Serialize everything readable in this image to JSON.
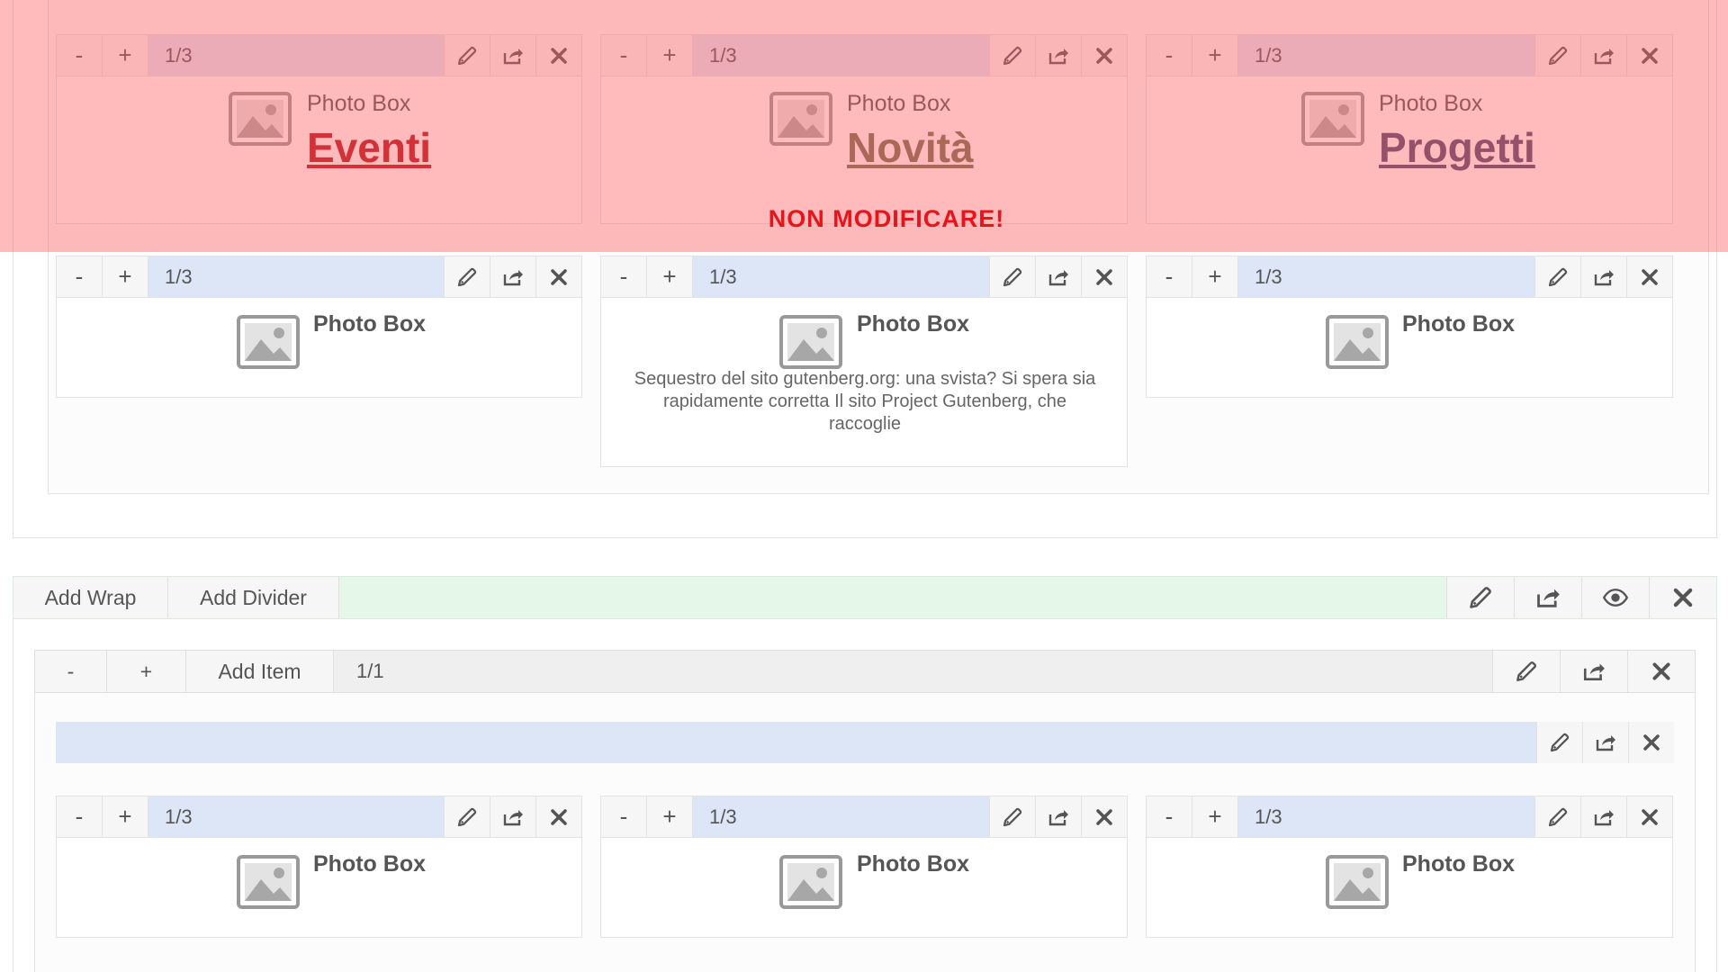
{
  "top_row": [
    {
      "size": "1/3",
      "title": "Photo Box",
      "link": "Eventi"
    },
    {
      "size": "1/3",
      "title": "Photo Box",
      "link": "Novità"
    },
    {
      "size": "1/3",
      "title": "Photo Box",
      "link": "Progetti"
    }
  ],
  "second_row": [
    {
      "size": "1/3",
      "title": "Photo Box"
    },
    {
      "size": "1/3",
      "title": "Photo Box",
      "excerpt_lines": [
        "Sequestro del sito gutenberg.org: una svista? Si spera sia",
        "rapidamente corretta Il sito Project Gutenberg, che",
        "raccoglie"
      ]
    },
    {
      "size": "1/3",
      "title": "Photo Box"
    }
  ],
  "warning": "NON MODIFICARE!",
  "wrap_bar": {
    "add_wrap": "Add Wrap",
    "add_divider": "Add Divider"
  },
  "row_bar": {
    "minus": "-",
    "plus": "+",
    "add_item": "Add Item",
    "size": "1/1"
  },
  "bottom_row": [
    {
      "size": "1/3",
      "title": "Photo Box"
    },
    {
      "size": "1/3",
      "title": "Photo Box"
    },
    {
      "size": "1/3",
      "title": "Photo Box"
    }
  ],
  "controls": {
    "minus": "-",
    "plus": "+"
  },
  "colors": {
    "eventi": "#b0131b",
    "novita": "#6f7054",
    "progetti": "#4a4a72",
    "warning": "#e8141b",
    "overlay": "#ff5a5f"
  },
  "icons": [
    "pencil-icon",
    "share-icon",
    "close-icon",
    "eye-icon",
    "image-placeholder-icon"
  ]
}
